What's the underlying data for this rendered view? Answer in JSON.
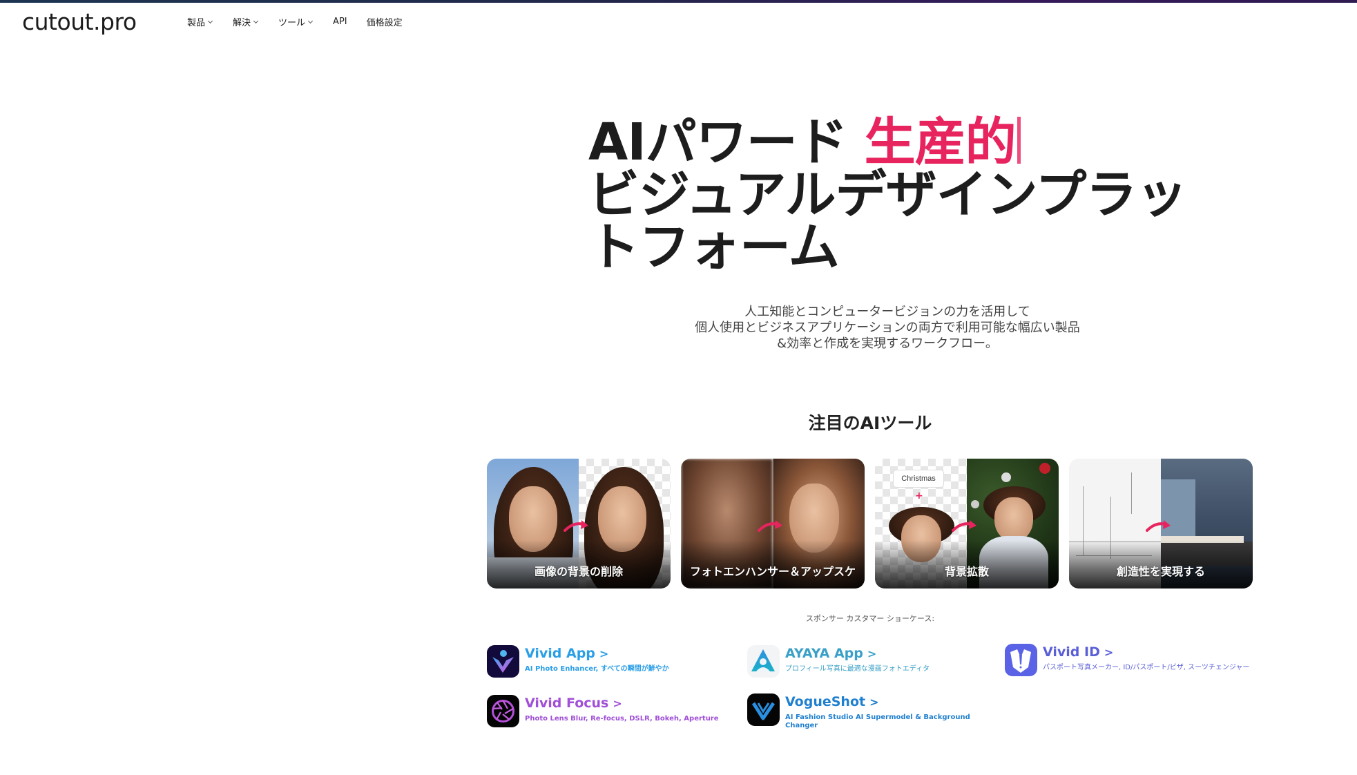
{
  "colors": {
    "accent_pink": "#e8245f",
    "vivid_app": "#2a9ee6",
    "ayaya_app": "#3aa0c8",
    "vivid_id": "#5a5fd6",
    "vivid_focus": "#a04fd6",
    "vogueshot": "#1f7fcf"
  },
  "header": {
    "logo": "cutout.pro",
    "nav": [
      {
        "label": "製品",
        "has_dropdown": true
      },
      {
        "label": "解決",
        "has_dropdown": true
      },
      {
        "label": "ツール",
        "has_dropdown": true
      },
      {
        "label": "API",
        "has_dropdown": false
      },
      {
        "label": "価格設定",
        "has_dropdown": false
      }
    ]
  },
  "hero": {
    "title_prefix": "AIパワード ",
    "title_accent": "生産的",
    "title_line2": "ビジュアルデザインプラッ",
    "title_line3": "トフォーム",
    "subtitle_lines": [
      "人工知能とコンピュータービジョンの力を活用して",
      "個人使用とビジネスアプリケーションの両方で利用可能な幅広い製品",
      "&効率と作成を実現するワークフロー。"
    ]
  },
  "featured": {
    "title": "注目のAIツール",
    "cards": [
      {
        "label": "画像の背景の削除"
      },
      {
        "label": "フォトエンハンサー＆アップスケ"
      },
      {
        "label": "背景拡散",
        "tag": "Christmas"
      },
      {
        "label": "創造性を実現する"
      }
    ]
  },
  "sponsors": {
    "caption": "スポンサー カスタマー ショーケース:",
    "apps": [
      {
        "name": "Vivid App",
        "desc": "AI Photo Enhancer, すべての瞬間が鮮やか",
        "icon": "vivid-app-icon"
      },
      {
        "name": "AYAYA App",
        "desc": "プロフィール写真に最適な漫画フォトエディタ",
        "icon": "ayaya-app-icon"
      },
      {
        "name": "Vivid ID",
        "desc": "パスポート写真メーカー, ID/パスポート/ビザ, スーツチェンジャー",
        "icon": "vivid-id-icon"
      },
      {
        "name": "Vivid Focus",
        "desc": "Photo Lens Blur, Re-focus, DSLR, Bokeh, Aperture",
        "icon": "vivid-focus-icon"
      },
      {
        "name": "VogueShot",
        "desc": "AI Fashion Studio AI Supermodel & Background Changer",
        "icon": "vogueshot-icon"
      }
    ],
    "chevron": ">"
  }
}
